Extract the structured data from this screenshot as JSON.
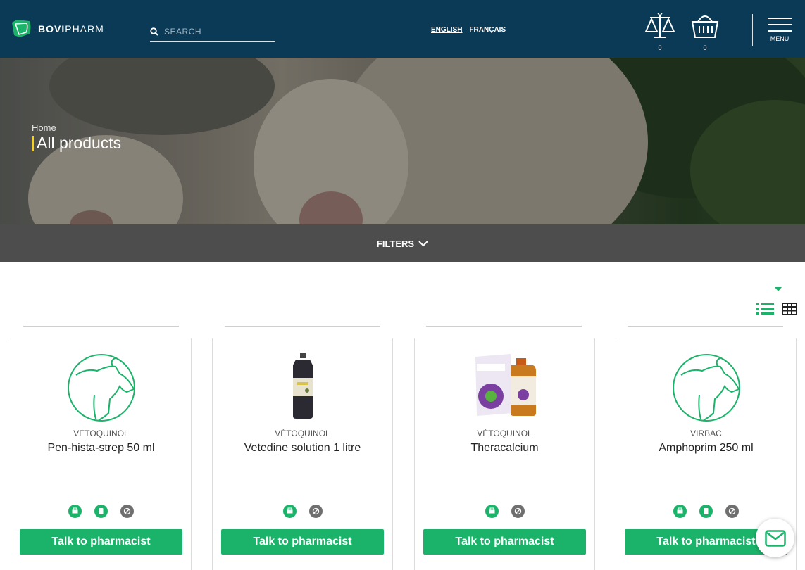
{
  "brand": {
    "name_bold": "BOVI",
    "name_light": "PHARM"
  },
  "search": {
    "placeholder": "SEARCH"
  },
  "languages": [
    {
      "label": "ENGLISH",
      "active": true
    },
    {
      "label": "FRANÇAIS",
      "active": false
    }
  ],
  "compare": {
    "icon": "scales-icon",
    "count": "0"
  },
  "cart": {
    "icon": "basket-icon",
    "count": "0"
  },
  "menu": {
    "label": "MENU"
  },
  "hero": {
    "breadcrumb": "Home",
    "title": "All products"
  },
  "filters": {
    "label": "FILTERS"
  },
  "products": [
    {
      "brand": "VETOQUINOL",
      "name": "Pen-hista-strep 50 ml",
      "image": "cow-placeholder",
      "badges": [
        "green",
        "green",
        "grey"
      ],
      "cta": "Talk to pharmacist"
    },
    {
      "brand": "VÉTOQUINOL",
      "name": "Vetedine solution 1 litre",
      "image": "dark-bottle",
      "badges": [
        "green",
        "grey"
      ],
      "cta": "Talk to pharmacist"
    },
    {
      "brand": "VÉTOQUINOL",
      "name": "Theracalcium",
      "image": "box-and-vial",
      "badges": [
        "green",
        "grey"
      ],
      "cta": "Talk to pharmacist"
    },
    {
      "brand": "VIRBAC",
      "name": "Amphoprim 250 ml",
      "image": "cow-placeholder",
      "badges": [
        "green",
        "green",
        "grey"
      ],
      "cta": "Talk to pharmacist"
    }
  ],
  "colors": {
    "header": "#0a3a56",
    "accent": "#1bb36a",
    "filters": "#4d4d4d",
    "title_bar": "#f7d117"
  }
}
